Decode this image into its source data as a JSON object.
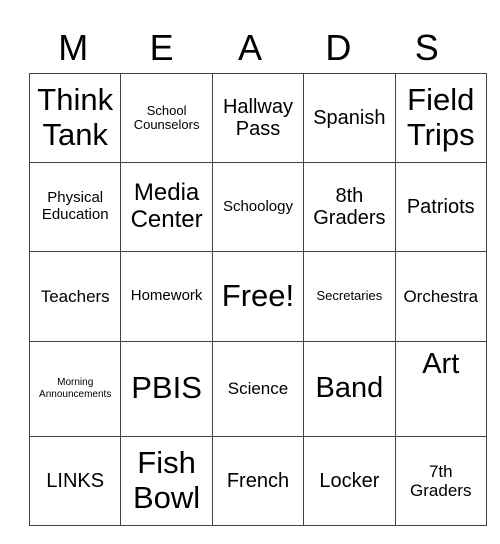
{
  "header": {
    "letters": [
      "M",
      "E",
      "A",
      "D",
      "S"
    ]
  },
  "board": {
    "rows": [
      [
        "Think Tank",
        "School Counselors",
        "Hallway Pass",
        "Spanish",
        "Field Trips"
      ],
      [
        "Physical Education",
        "Media Center",
        "Schoology",
        "8th Graders",
        "Patriots"
      ],
      [
        "Teachers",
        "Homework",
        "Free!",
        "Secretaries",
        "Orchestra"
      ],
      [
        "Morning Announcements",
        "PBIS",
        "Science",
        "Band",
        "Art"
      ],
      [
        "LINKS",
        "Fish Bowl",
        "French",
        "Locker",
        "7th Graders"
      ]
    ]
  }
}
